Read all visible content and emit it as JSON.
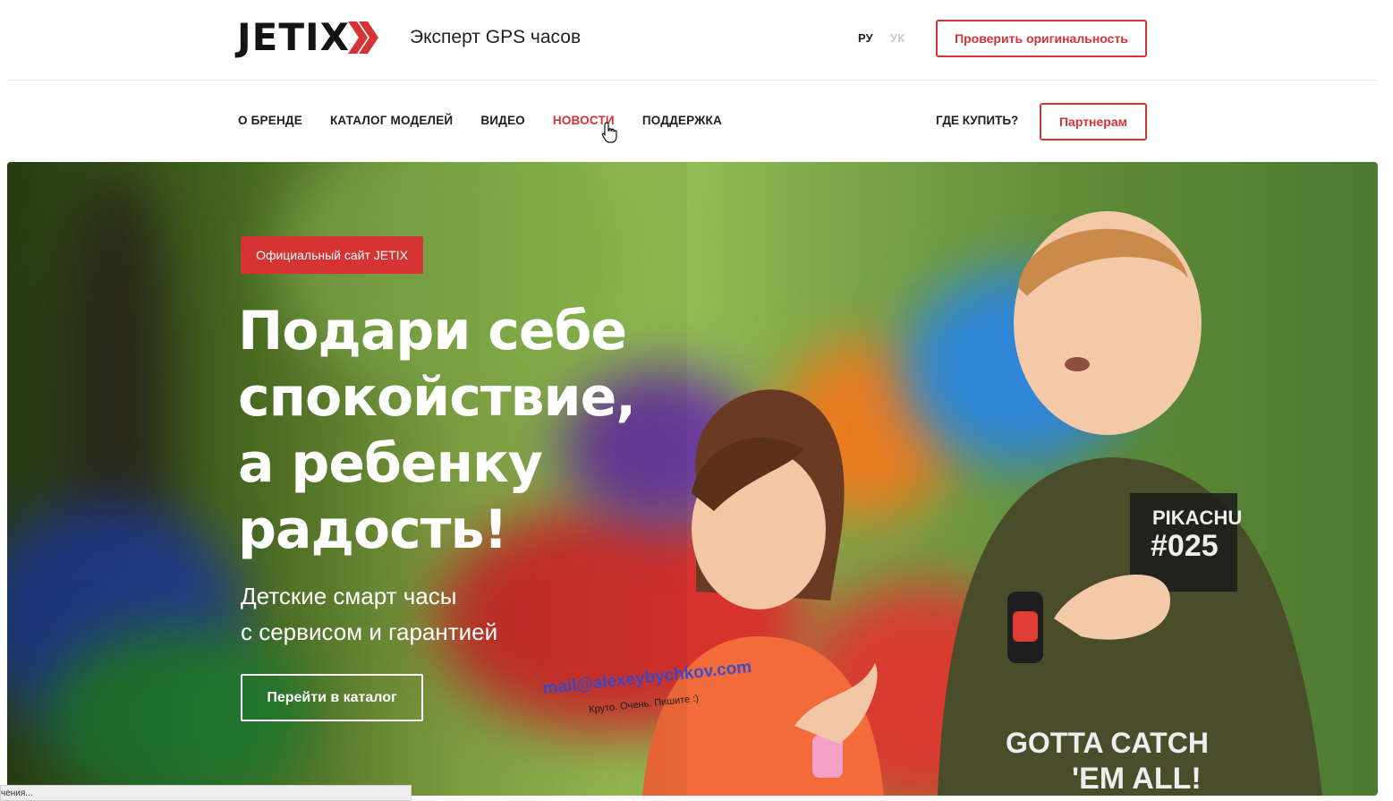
{
  "header": {
    "logo_text": "JETIX",
    "tagline": "Эксперт GPS часов",
    "lang_ru": "РУ",
    "lang_uk": "УК",
    "check_button": "Проверить оригинальность"
  },
  "nav": {
    "items": [
      {
        "label": "О БРЕНДЕ"
      },
      {
        "label": "КАТАЛОГ МОДЕЛЕЙ"
      },
      {
        "label": "ВИДЕО"
      },
      {
        "label": "НОВОСТИ"
      },
      {
        "label": "ПОДДЕРЖКА"
      }
    ],
    "active_item": "НОВОСТИ",
    "where_to_buy": "ГДЕ КУПИТЬ?",
    "partners_button": "Партнерам"
  },
  "hero": {
    "badge": "Официальный сайт JETIX",
    "headline_1": "Подари себе",
    "headline_2": "спокойствие,",
    "headline_3": "а ребенку",
    "headline_4": "радость!",
    "sub_1": "Детские смарт часы",
    "sub_2": "с сервисом и гарантией",
    "cta": "Перейти в каталог",
    "watermark": "mail@alexeybychkov.com",
    "watermark_note": "Круто. Очень. Пишите :)",
    "shirt_text_1": "PIKACHU",
    "shirt_text_2": "#025",
    "shirt_text_3": "GOTTA CATCH",
    "shirt_text_4": "'EM ALL!"
  },
  "status_bar": {
    "text": "чения..."
  },
  "colors": {
    "accent": "#d63334",
    "text": "#1f1f1f"
  }
}
